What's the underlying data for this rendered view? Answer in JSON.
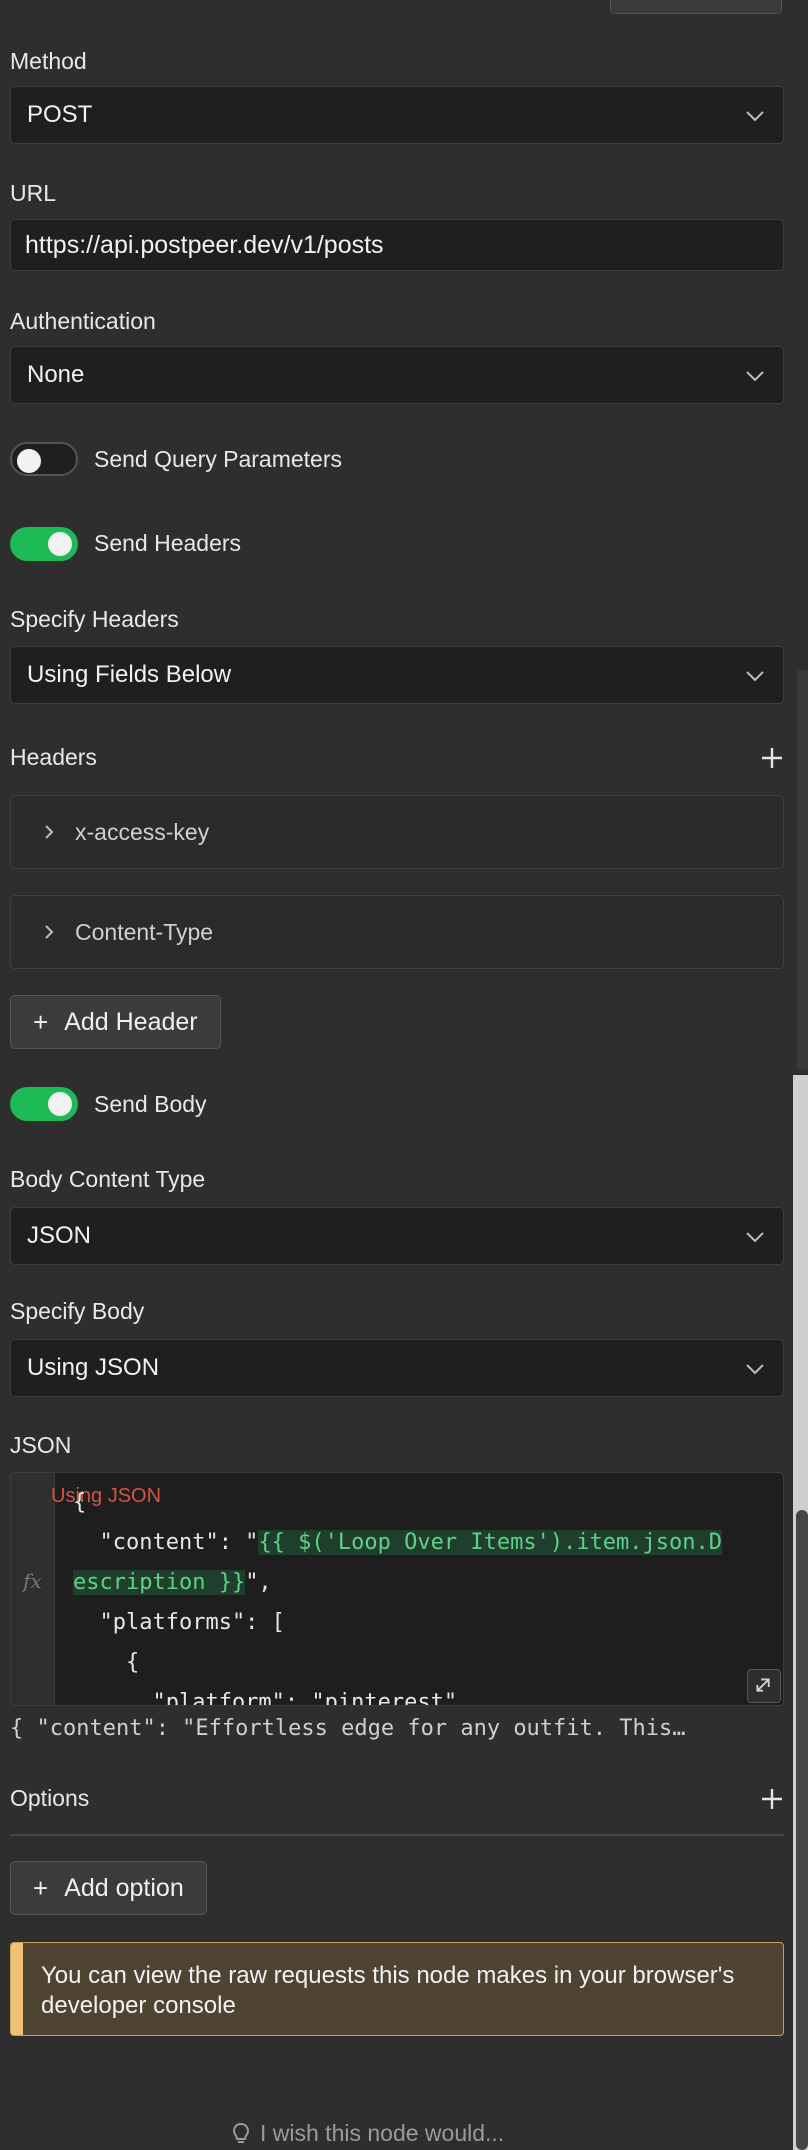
{
  "method": {
    "label": "Method",
    "value": "POST"
  },
  "url": {
    "label": "URL",
    "value": "https://api.postpeer.dev/v1/posts"
  },
  "authentication": {
    "label": "Authentication",
    "value": "None"
  },
  "send_query": {
    "label": "Send Query Parameters",
    "enabled": false
  },
  "send_headers": {
    "label": "Send Headers",
    "enabled": true
  },
  "specify_headers": {
    "label": "Specify Headers",
    "value": "Using Fields Below"
  },
  "headers": {
    "label": "Headers",
    "items": [
      {
        "name": "x-access-key"
      },
      {
        "name": "Content-Type"
      }
    ],
    "add_label": "Add Header"
  },
  "send_body": {
    "label": "Send Body",
    "enabled": true
  },
  "body_content_type": {
    "label": "Body Content Type",
    "value": "JSON"
  },
  "specify_body": {
    "label": "Specify Body",
    "value": "Using JSON"
  },
  "json_editor": {
    "label": "JSON",
    "ghost": "Using JSON",
    "fx_label": "fx",
    "line1": "{",
    "line2_key": "  \"content\": \"",
    "line2_expr_a": "{{ $('Loop Over Items').item.json.D",
    "line3_expr_b": "escription }}",
    "line3_tail": "\",",
    "line4": "  \"platforms\": [",
    "line5": "    {",
    "line6": "      \"platform\": \"pinterest\""
  },
  "json_preview": "{   \"content\": \"Effortless edge for any outfit. This…",
  "options": {
    "label": "Options",
    "add_label": "Add option"
  },
  "notice": {
    "text": "You can view the raw requests this node makes in your browser's developer console"
  },
  "feedback": {
    "text": "I wish this node would..."
  },
  "colors": {
    "toggle_on": "#1db954",
    "notice_bg": "#4f4332",
    "notice_bar": "#f0c27a",
    "expr_highlight": "#5fd08a"
  }
}
